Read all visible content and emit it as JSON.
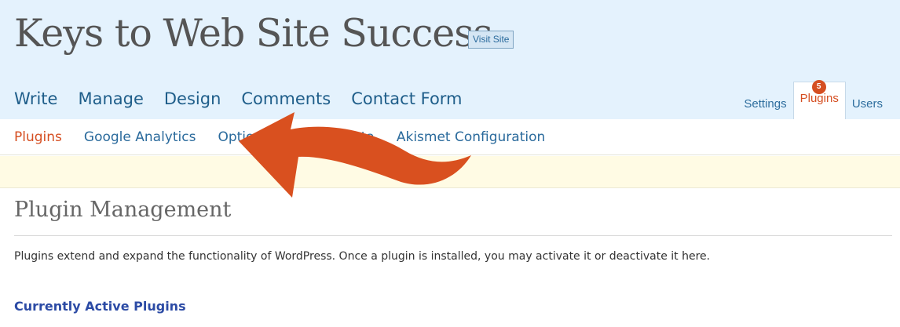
{
  "header": {
    "site_title": "Keys to Web Site Success",
    "visit_site_label": "Visit Site"
  },
  "main_nav": {
    "items": [
      {
        "label": "Write"
      },
      {
        "label": "Manage"
      },
      {
        "label": "Design"
      },
      {
        "label": "Comments"
      },
      {
        "label": "Contact Form"
      }
    ]
  },
  "secondary_nav": {
    "items": [
      {
        "label": "Settings"
      },
      {
        "label": "Plugins",
        "current": true
      },
      {
        "label": "Users"
      }
    ],
    "plugin_update_count": "5"
  },
  "submenu": {
    "items": [
      {
        "label": "Plugins",
        "current": true
      },
      {
        "label": "Google Analytics"
      },
      {
        "label": "Options"
      },
      {
        "label": "Robots Meta"
      },
      {
        "label": "Akismet Configuration"
      }
    ]
  },
  "page": {
    "title": "Plugin Management",
    "intro": "Plugins extend and expand the functionality of WordPress. Once a plugin is installed, you may activate it or deactivate it here.",
    "active_heading": "Currently Active Plugins"
  },
  "colors": {
    "header_bg": "#e4f2fd",
    "accent": "#d54e21",
    "link": "#2a6a9c",
    "arrow": "#d9501f",
    "notice_bg": "#fffbe4"
  },
  "annotation": {
    "icon": "curved-arrow-left-icon"
  }
}
